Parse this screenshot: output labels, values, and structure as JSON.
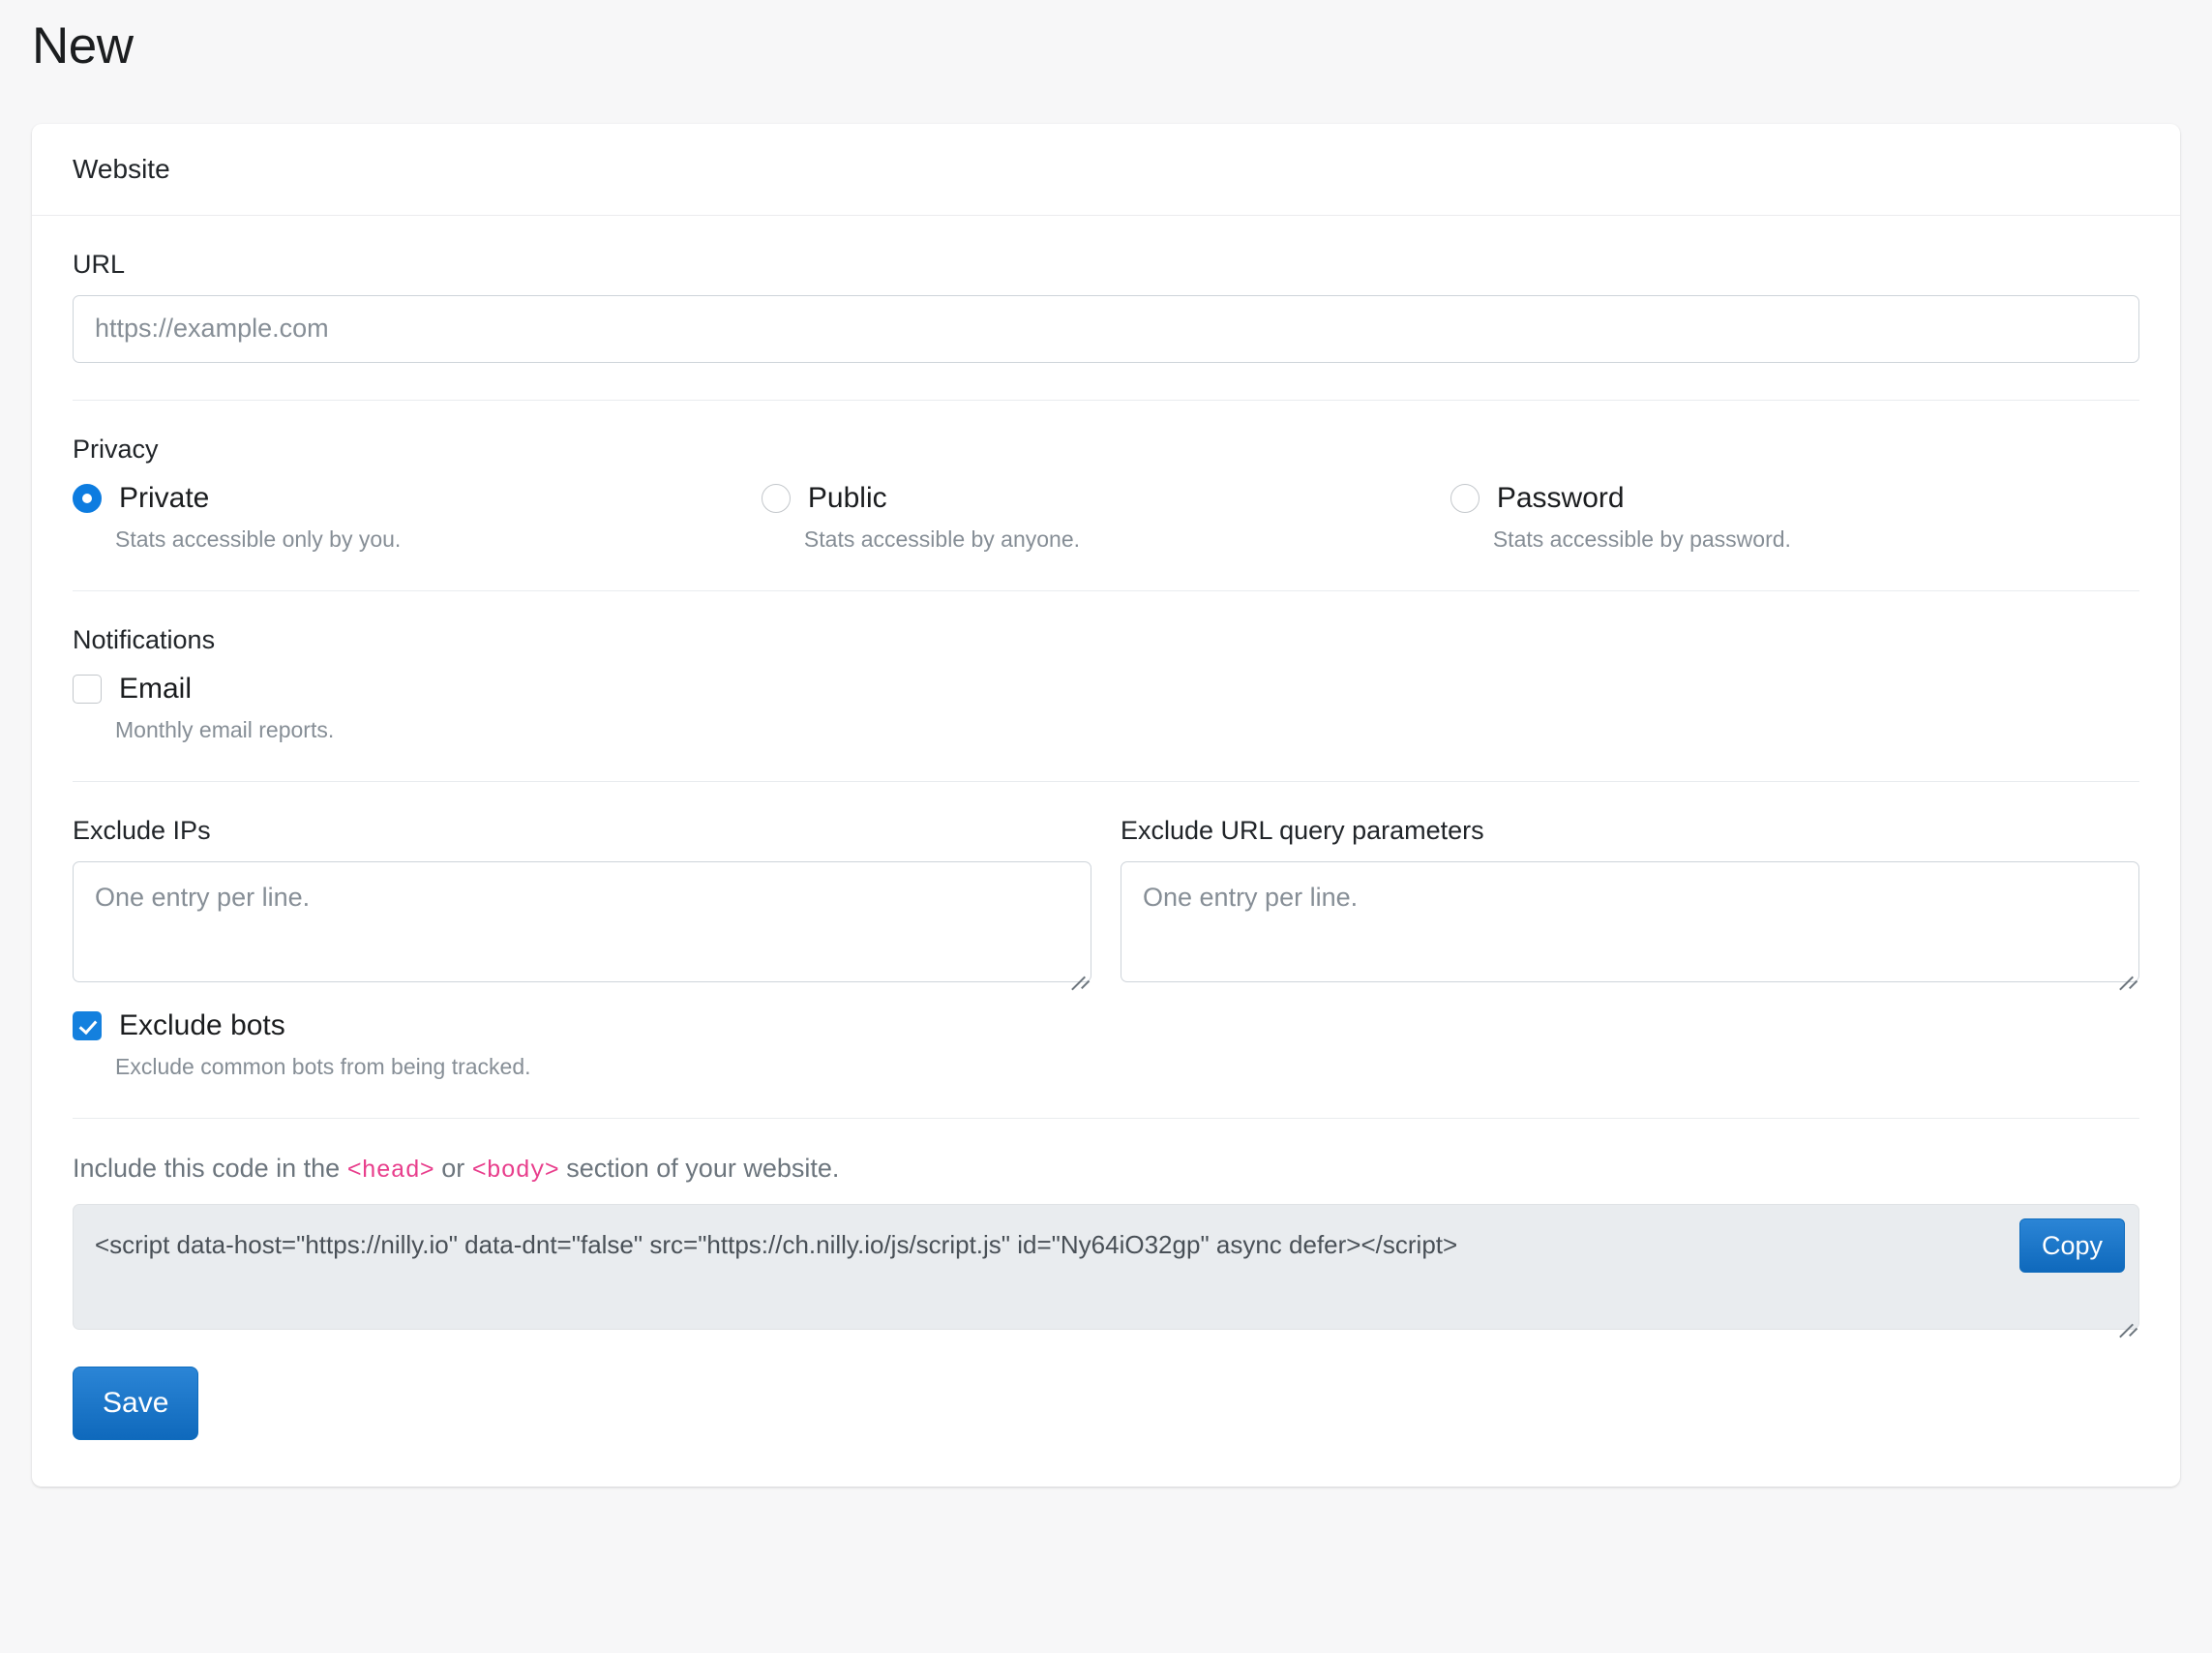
{
  "page": {
    "title": "New"
  },
  "card": {
    "header": "Website"
  },
  "url": {
    "label": "URL",
    "placeholder": "https://example.com",
    "value": ""
  },
  "privacy": {
    "label": "Privacy",
    "options": [
      {
        "label": "Private",
        "help": "Stats accessible only by you.",
        "selected": true
      },
      {
        "label": "Public",
        "help": "Stats accessible by anyone.",
        "selected": false
      },
      {
        "label": "Password",
        "help": "Stats accessible by password.",
        "selected": false
      }
    ]
  },
  "notifications": {
    "label": "Notifications",
    "email": {
      "label": "Email",
      "help": "Monthly email reports.",
      "checked": false
    }
  },
  "exclude_ips": {
    "label": "Exclude IPs",
    "placeholder": "One entry per line.",
    "value": ""
  },
  "exclude_query_params": {
    "label": "Exclude URL query parameters",
    "placeholder": "One entry per line.",
    "value": ""
  },
  "exclude_bots": {
    "label": "Exclude bots",
    "help": "Exclude common bots from being tracked.",
    "checked": true
  },
  "snippet": {
    "note_part1": "Include this code in the ",
    "tag_head": "<head>",
    "note_part2": " or ",
    "tag_body": "<body>",
    "note_part3": " section of your website.",
    "code": "<script data-host=\"https://nilly.io\" data-dnt=\"false\" src=\"https://ch.nilly.io/js/script.js\" id=\"Ny64iO32gp\" async defer></script>",
    "copy_label": "Copy"
  },
  "actions": {
    "save_label": "Save"
  },
  "colors": {
    "accent_blue": "#1480de",
    "button_blue_top": "#2b85d6",
    "button_blue_bottom": "#0f69bc",
    "code_tag_pink": "#e83e8c",
    "page_bg": "#f7f7f8",
    "code_bg": "#e9ecef",
    "muted_text": "#868e96"
  }
}
